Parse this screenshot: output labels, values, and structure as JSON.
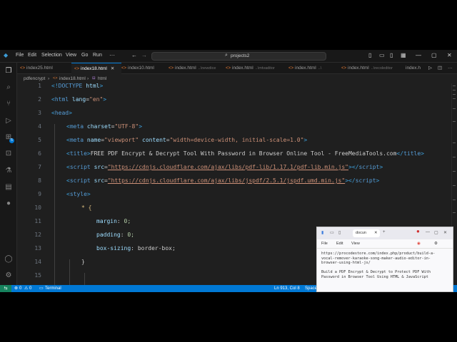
{
  "titlebar": {
    "menu": [
      "File",
      "Edit",
      "Selection",
      "View",
      "Go",
      "Run"
    ],
    "search_text": "projects2"
  },
  "activity_bar": {
    "icons": [
      "files-icon",
      "search-icon",
      "source-control-icon",
      "run-debug-icon",
      "extensions-icon",
      "remote-icon",
      "testing-icon",
      "chart-icon",
      "github-icon",
      "docker-icon"
    ],
    "extensions_badge": "5",
    "bottom_icons": [
      "account-icon",
      "settings-icon"
    ]
  },
  "tabs": [
    {
      "label": "index25.html",
      "desc": ""
    },
    {
      "label": "index18.html",
      "desc": "",
      "active": true
    },
    {
      "label": "index10.html",
      "desc": ""
    },
    {
      "label": "index.html",
      "desc": "..\\newdice"
    },
    {
      "label": "index.html",
      "desc": "..\\mtvaditor"
    },
    {
      "label": "index.html",
      "desc": "..\\"
    },
    {
      "label": "index.html",
      "desc": "..\\recoleditor"
    },
    {
      "label": "index.h",
      "desc": ""
    }
  ],
  "breadcrumb": [
    "pdfencrypt",
    "index18.html",
    "html"
  ],
  "editor": {
    "line_numbers": [
      "1",
      "2",
      "3",
      "4",
      "5",
      "6",
      "7",
      "8",
      "9",
      "10",
      "11",
      "12",
      "13",
      "14",
      "15"
    ],
    "lines": [
      {
        "t": "<!DOCTYPE ",
        "n": "html",
        "e": ">"
      },
      {
        "t": "lang",
        "v": "\"en\""
      },
      {},
      {
        "a": "charset",
        "v": "\"UTF-8\""
      },
      {
        "a1": "name",
        "v1": "\"viewport\"",
        "a2": "content",
        "v2": "\"width=device-width, initial-scale=1.0\""
      },
      {
        "text": "FREE PDF Encrypt & Decrypt Tool With Password in Browser Online Tool - FreeMediaTools.com"
      },
      {
        "url": "\"https://cdnjs.cloudflare.com/ajax/libs/pdf-lib/1.17.1/pdf-lib.min.js\""
      },
      {
        "url": "\"https://cdnjs.cloudflare.com/ajax/libs/jspdf/2.5.1/jspdf.umd.min.js\""
      },
      {},
      {
        "sel": "* {"
      },
      {
        "p": "margin",
        "v": "0;"
      },
      {
        "p": "padding",
        "v": "0;"
      },
      {
        "p": "box-sizing",
        "v": "border-box;"
      },
      {
        "e": "}"
      },
      {}
    ]
  },
  "status": {
    "errors": "0",
    "warnings": "0",
    "terminal": "Terminal",
    "position": "Ln 913, Col 8",
    "spaces": "Space"
  },
  "popup": {
    "tab_label": "docun",
    "menu": [
      "File",
      "Edit",
      "View"
    ],
    "text": "https://procodestore.com/index.php/product/build-a-vocal-remover-karaoke-song-maker-audio-editor-in-browser-using-html-js/\n\nBuild a PDF Encrypt & Decrypt to Protect PDF With Password in Browser Tool Using HTML & JavaScript"
  },
  "colors": {
    "accent": "#0078d4",
    "remote": "#16825d",
    "editor_bg": "#1f1f1f"
  }
}
